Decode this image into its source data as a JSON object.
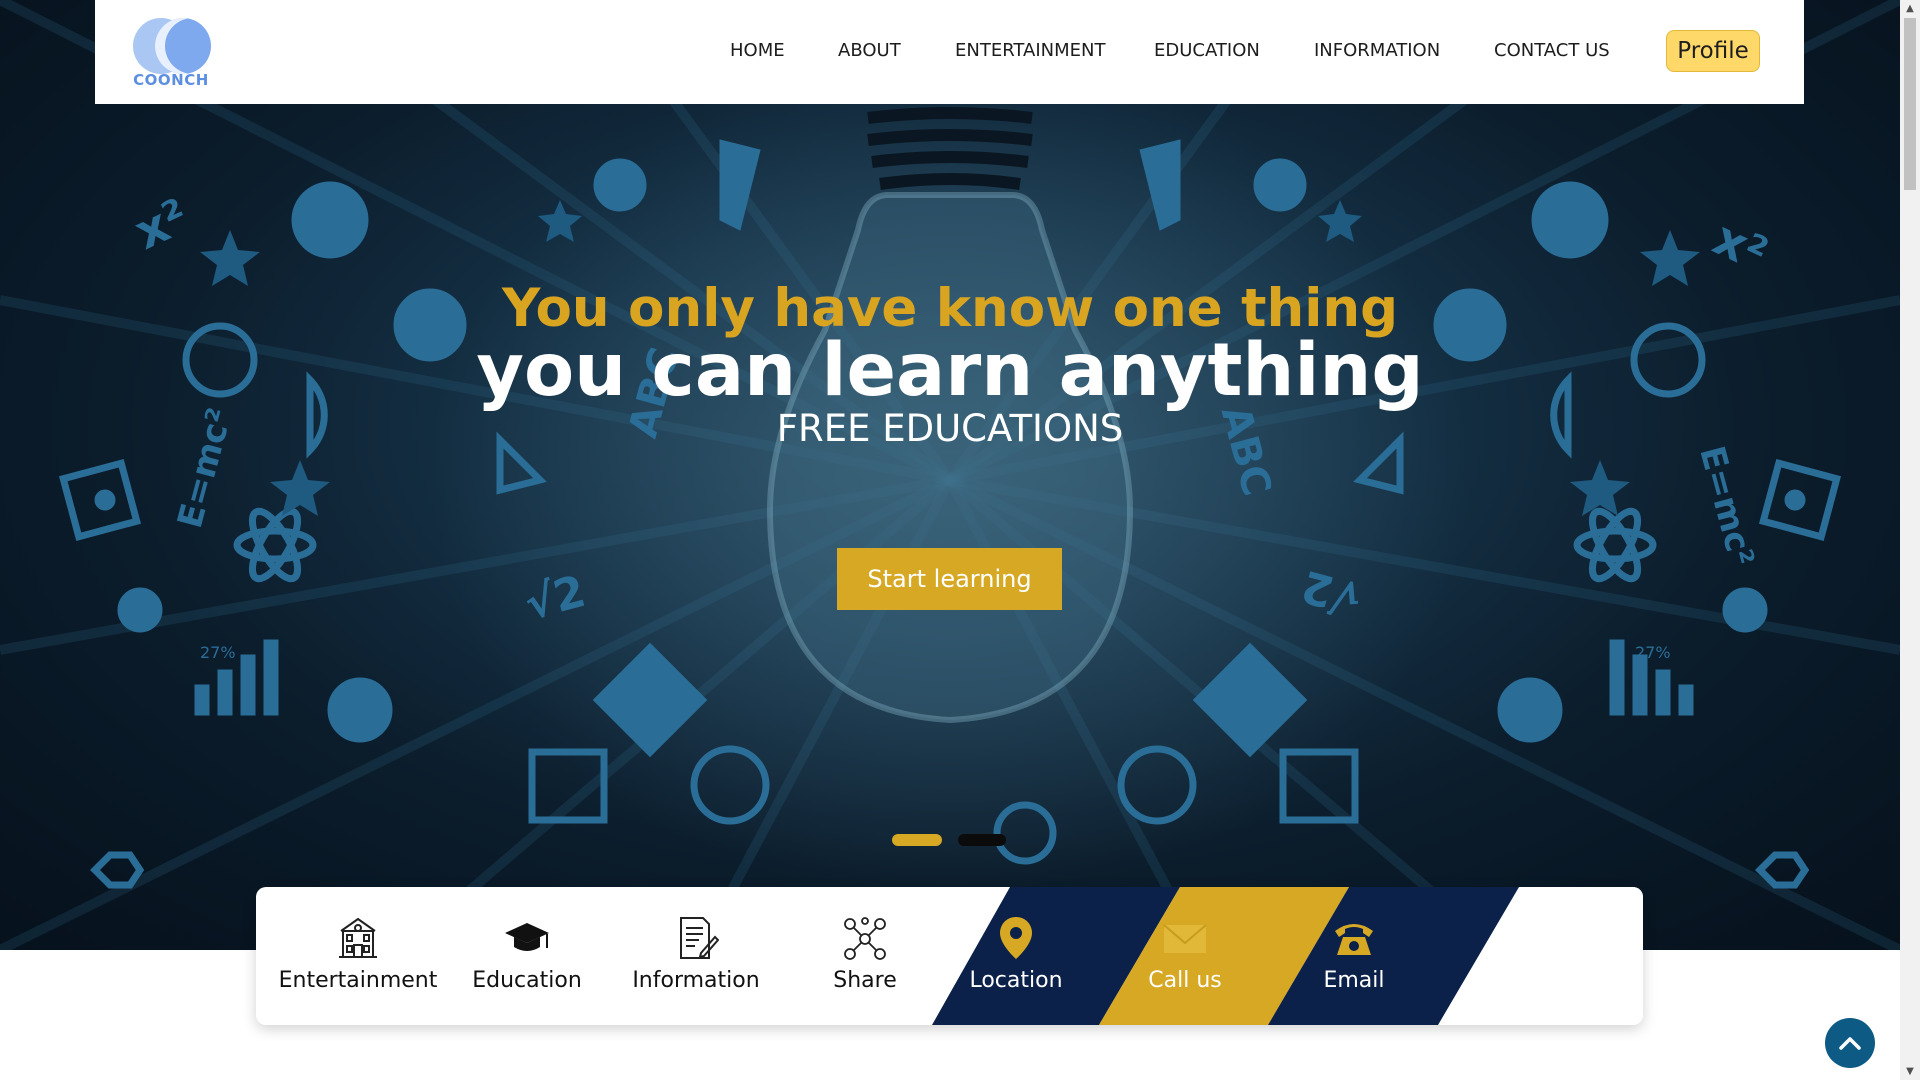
{
  "brand": {
    "logo_text": "COONCH"
  },
  "nav": {
    "items": [
      "HOME",
      "ABOUT",
      "ENTERTAINMENT",
      "EDUCATION",
      "INFORMATION",
      "CONTACT US"
    ],
    "profile_label": "Profile"
  },
  "hero": {
    "line1": "You only have know one thing",
    "line2": "you can learn anything",
    "line3": "FREE EDUCATIONS",
    "cta_label": "Start learning",
    "chalk_percent": "27%"
  },
  "features": [
    {
      "label": "Entertainment",
      "icon": "building-icon"
    },
    {
      "label": "Education",
      "icon": "graduation-cap-icon"
    },
    {
      "label": "Information",
      "icon": "document-icon"
    },
    {
      "label": "Share",
      "icon": "share-network-icon"
    },
    {
      "label": "Location",
      "icon": "location-pin-icon"
    },
    {
      "label": "Call us",
      "icon": "envelope-icon"
    },
    {
      "label": "Email",
      "icon": "telephone-icon"
    }
  ],
  "colors": {
    "accent": "#d7a823",
    "navy": "#0b2149",
    "hero_bg": "#0b1c2b",
    "chalk_blue": "#2a6e98",
    "profile_btn": "#ffd86a"
  },
  "carousel": {
    "total_slides": 2,
    "active_slide": 1
  }
}
